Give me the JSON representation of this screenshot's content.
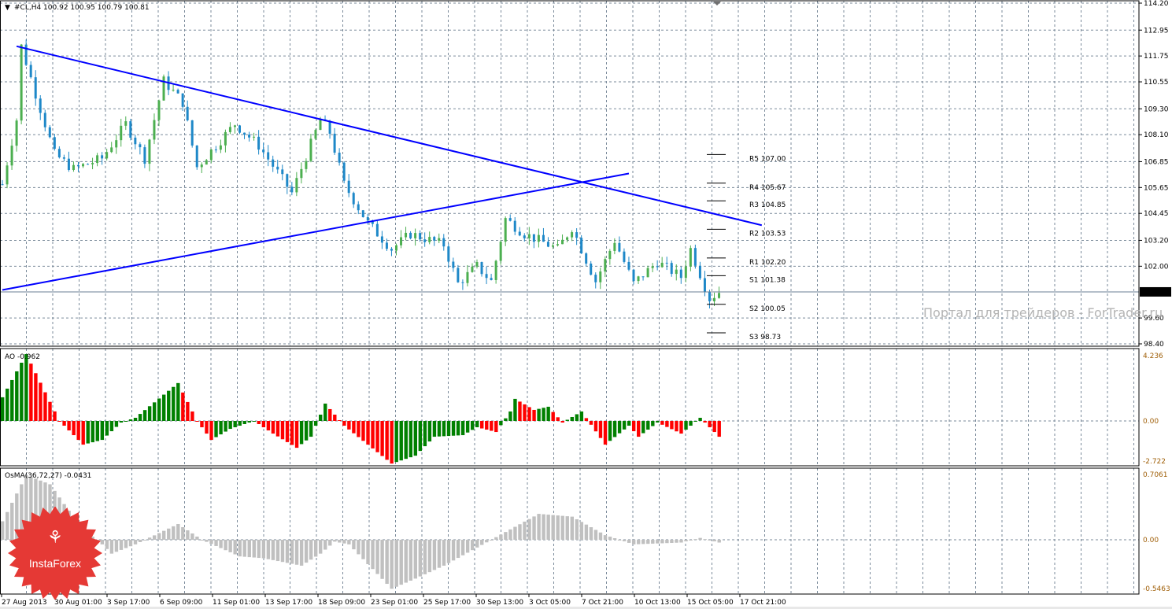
{
  "header": {
    "symbol": "#CL,H4",
    "ohlc": "100.92 100.95 100.79 100.81"
  },
  "price_axis": {
    "ticks": [
      "114.20",
      "112.95",
      "111.75",
      "110.55",
      "109.30",
      "108.10",
      "106.85",
      "105.65",
      "104.45",
      "103.20",
      "102.00",
      "99.60",
      "98.40"
    ],
    "current": "100.81"
  },
  "time_axis": {
    "labels": [
      "27 Aug 2013",
      "30 Aug 01:00",
      "3 Sep 17:00",
      "6 Sep 09:00",
      "11 Sep 01:00",
      "13 Sep 17:00",
      "18 Sep 09:00",
      "23 Sep 01:00",
      "25 Sep 17:00",
      "30 Sep 13:00",
      "3 Oct 05:00",
      "7 Oct 21:00",
      "10 Oct 13:00",
      "15 Oct 05:00",
      "17 Oct 21:00"
    ]
  },
  "pivots": [
    {
      "label": "R5 107.00",
      "v": 107.0
    },
    {
      "label": "R4 105.67",
      "v": 105.67
    },
    {
      "label": "R3 104.85",
      "v": 104.85
    },
    {
      "label": "R2 103.53",
      "v": 103.53
    },
    {
      "label": "R1 102.20",
      "v": 102.2
    },
    {
      "label": "S1 101.38",
      "v": 101.38
    },
    {
      "label": "S2 100.05",
      "v": 100.05
    },
    {
      "label": "S3 98.73",
      "v": 98.73
    }
  ],
  "ao": {
    "title": "AO -0.962",
    "ticks": [
      "4.236",
      "0.00",
      "-2.722"
    ]
  },
  "osma": {
    "title": "OsMA(36,72,27) -0.0431",
    "ticks": [
      "0.7061",
      "0.00",
      "-0.5463"
    ]
  },
  "watermark": "Портал для трейдеров - ForTrader.ru",
  "logo": "InstaForex",
  "colors": {
    "bull": "#4caf50",
    "bear": "#1e88c8",
    "trend": "#0000ff",
    "ao_up": "#008000",
    "ao_down": "#ff0000",
    "osma": "#c0c0c0",
    "logo": "#e53935"
  },
  "chart_data": {
    "type": "candlestick",
    "price_range": [
      98.4,
      114.2
    ],
    "price_path": [
      [
        0,
        105.8
      ],
      [
        3,
        108.8
      ],
      [
        4,
        112.2
      ],
      [
        7,
        110.0
      ],
      [
        11,
        107.2
      ],
      [
        15,
        106.5
      ],
      [
        21,
        107.0
      ],
      [
        26,
        108.6
      ],
      [
        30,
        107.0
      ],
      [
        34,
        110.6
      ],
      [
        38,
        109.6
      ],
      [
        41,
        106.6
      ],
      [
        49,
        108.6
      ],
      [
        54,
        107.6
      ],
      [
        61,
        105.4
      ],
      [
        67,
        108.8
      ],
      [
        69,
        108.2
      ],
      [
        72,
        105.8
      ],
      [
        77,
        104.0
      ],
      [
        82,
        102.8
      ],
      [
        86,
        103.5
      ],
      [
        93,
        103.0
      ],
      [
        96,
        101.2
      ],
      [
        100,
        102.0
      ],
      [
        103,
        101.3
      ],
      [
        106,
        104.2
      ],
      [
        110,
        103.5
      ],
      [
        117,
        102.8
      ],
      [
        120,
        103.8
      ],
      [
        125,
        101.3
      ],
      [
        129,
        103.2
      ],
      [
        133,
        101.2
      ],
      [
        138,
        102.2
      ],
      [
        143,
        101.5
      ],
      [
        145,
        102.8
      ],
      [
        149,
        100.5
      ],
      [
        151,
        100.81
      ]
    ],
    "ao_path": [
      [
        0,
        1.5
      ],
      [
        5,
        4.236
      ],
      [
        12,
        0
      ],
      [
        17,
        -1.5
      ],
      [
        21,
        -1.2
      ],
      [
        25,
        -0.1
      ],
      [
        28,
        0.2
      ],
      [
        37,
        2.4
      ],
      [
        41,
        0
      ],
      [
        44,
        -1.2
      ],
      [
        48,
        -0.5
      ],
      [
        53,
        0
      ],
      [
        57,
        -0.8
      ],
      [
        62,
        -1.7
      ],
      [
        65,
        -1.0
      ],
      [
        68,
        1.1
      ],
      [
        72,
        -0.3
      ],
      [
        77,
        -1.5
      ],
      [
        82,
        -2.7
      ],
      [
        87,
        -2.2
      ],
      [
        91,
        -1.0
      ],
      [
        97,
        -0.9
      ],
      [
        100,
        -0.4
      ],
      [
        104,
        -0.7
      ],
      [
        107,
        0.6
      ],
      [
        108,
        1.4
      ],
      [
        112,
        0.7
      ],
      [
        115,
        0.9
      ],
      [
        118,
        -0.1
      ],
      [
        122,
        0.6
      ],
      [
        127,
        -1.5
      ],
      [
        132,
        -0.3
      ],
      [
        134,
        -1.0
      ],
      [
        138,
        -0.1
      ],
      [
        143,
        -0.8
      ],
      [
        147,
        0.2
      ],
      [
        151,
        -1.0
      ]
    ],
    "osma_path": [
      [
        0,
        0.2
      ],
      [
        5,
        0.7
      ],
      [
        10,
        0.6
      ],
      [
        17,
        0.1
      ],
      [
        20,
        0
      ],
      [
        23,
        -0.15
      ],
      [
        28,
        -0.05
      ],
      [
        37,
        0.17
      ],
      [
        42,
        0
      ],
      [
        50,
        -0.18
      ],
      [
        55,
        -0.2
      ],
      [
        63,
        -0.28
      ],
      [
        67,
        -0.15
      ],
      [
        70,
        -0.02
      ],
      [
        73,
        -0.05
      ],
      [
        82,
        -0.53
      ],
      [
        87,
        -0.42
      ],
      [
        93,
        -0.28
      ],
      [
        103,
        0
      ],
      [
        113,
        0.28
      ],
      [
        120,
        0.25
      ],
      [
        127,
        0.05
      ],
      [
        133,
        -0.05
      ],
      [
        143,
        -0.03
      ],
      [
        147,
        0.02
      ],
      [
        151,
        -0.03
      ]
    ],
    "trendlines": [
      {
        "from": [
          3,
          112.2
        ],
        "to": [
          160,
          103.9
        ]
      },
      {
        "from": [
          0,
          100.9
        ],
        "to": [
          132,
          106.3
        ]
      }
    ]
  }
}
